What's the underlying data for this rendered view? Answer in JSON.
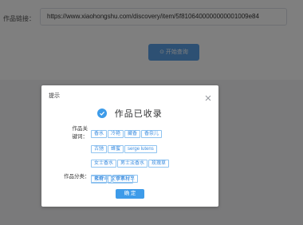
{
  "background": {
    "field_label": "作品链接：",
    "url_value": "https://www.xiaohongshu.com/discovery/item/5f8106400000000001009e84",
    "query_button": "开始查询"
  },
  "dialog": {
    "title": "提示",
    "success_message": "作品已收录",
    "keywords_label": "作品关键词：",
    "keywords": [
      "香水",
      "冷艳",
      "藏香",
      "香奈儿",
      "古驰",
      "蜂蜜",
      "serge lutens",
      "女士香水",
      "男士淡香水",
      "玫瑰草",
      "花香调",
      "香水分享"
    ],
    "category_label": "作品分类：",
    "categories": [
      "素材",
      "文字素材"
    ],
    "confirm_button": "确 定"
  },
  "colors": {
    "accent": "#3d9be9",
    "tag_border": "#8fc3f0",
    "tag_text": "#3d8ee0",
    "overlay": "rgba(0,0,0,0.5)"
  },
  "icons": {
    "success": "check-circle-icon",
    "close": "close-icon",
    "query": "search-icon"
  }
}
